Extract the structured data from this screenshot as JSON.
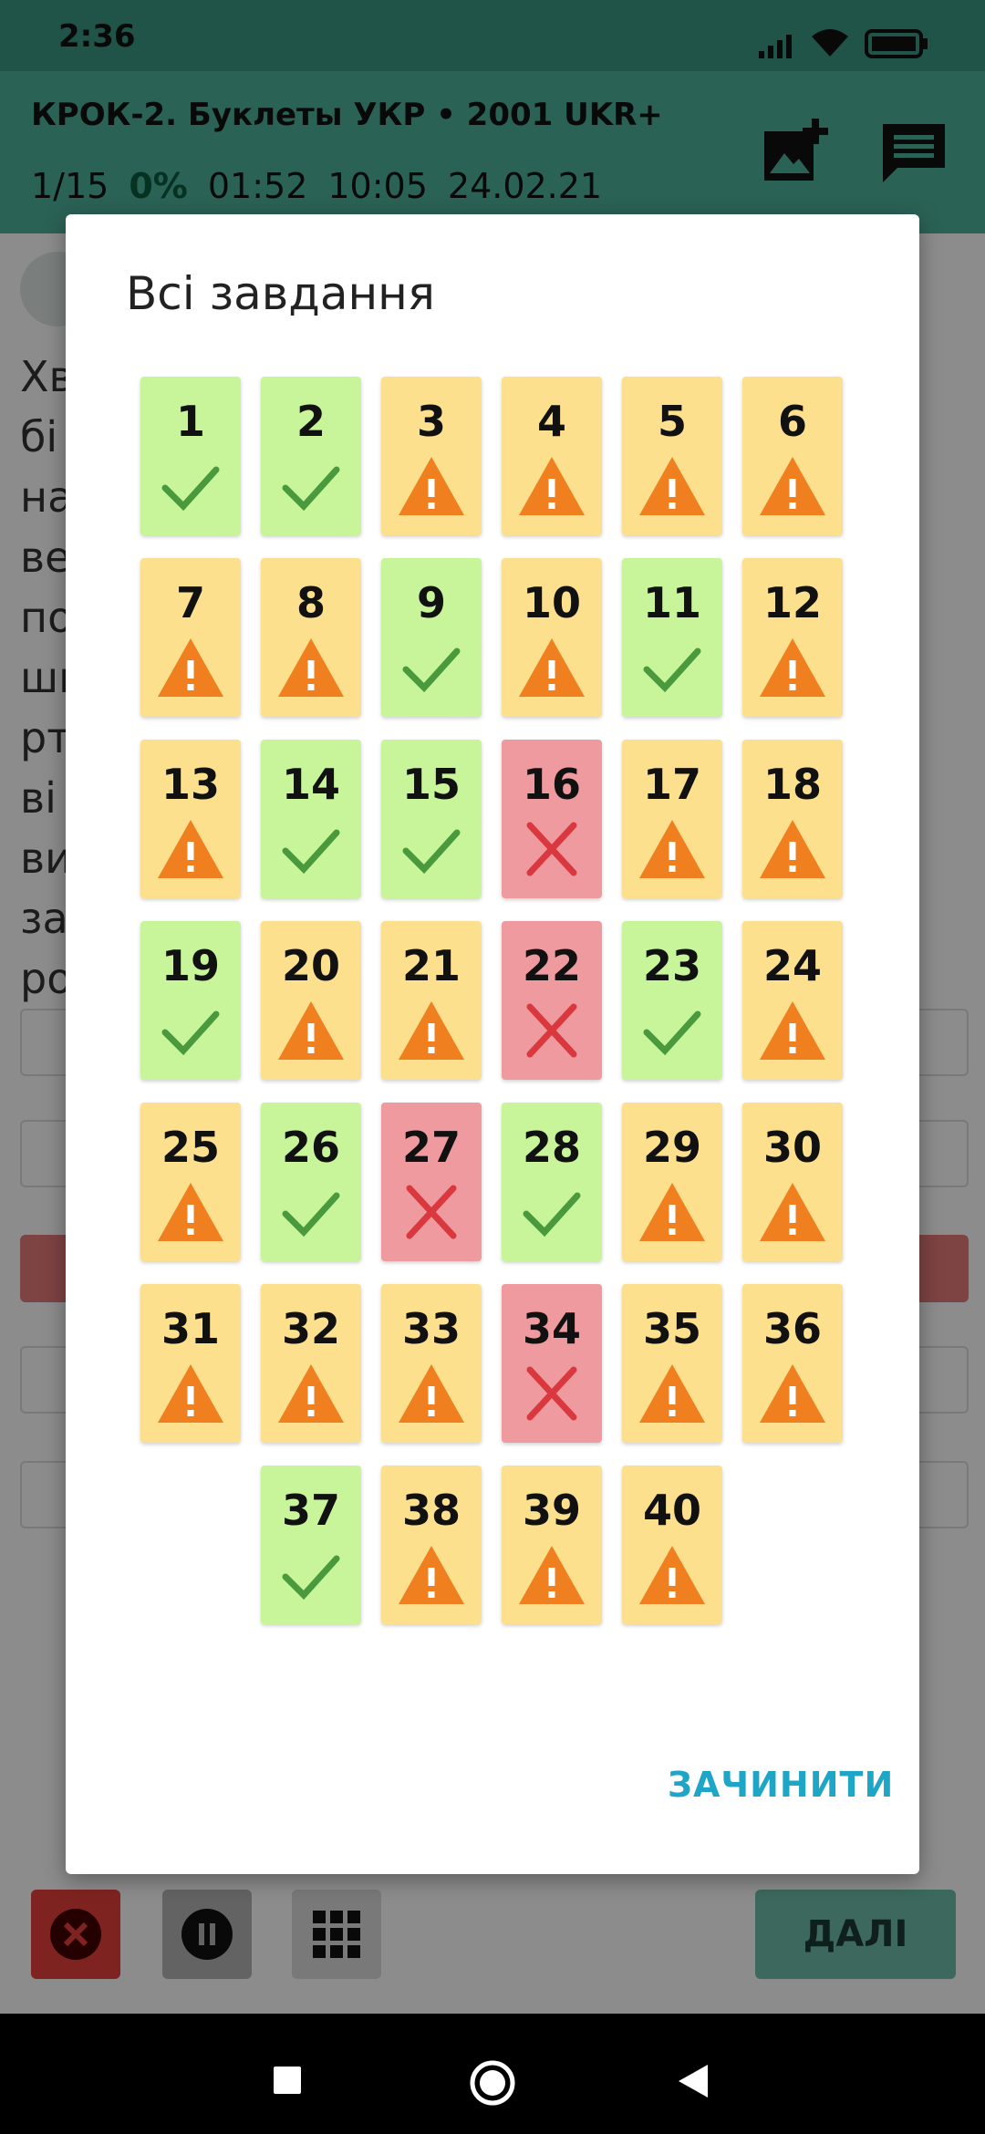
{
  "status_bar": {
    "time": "2:36"
  },
  "app_bar": {
    "title": "КРОК-2. Буклеты УКР • 2001 UKR+",
    "progress": "1/15",
    "percent": "0%",
    "elapsed": "01:52",
    "clock": "10:05",
    "date": "24.02.21"
  },
  "background": {
    "next_label": "ДАЛІ"
  },
  "dialog": {
    "title": "Всі завдання",
    "close_label": "ЗАЧИНИТИ",
    "tasks": [
      {
        "number": "1",
        "status": "correct"
      },
      {
        "number": "2",
        "status": "correct"
      },
      {
        "number": "3",
        "status": "warning"
      },
      {
        "number": "4",
        "status": "warning"
      },
      {
        "number": "5",
        "status": "warning"
      },
      {
        "number": "6",
        "status": "warning"
      },
      {
        "number": "7",
        "status": "warning"
      },
      {
        "number": "8",
        "status": "warning"
      },
      {
        "number": "9",
        "status": "correct"
      },
      {
        "number": "10",
        "status": "warning"
      },
      {
        "number": "11",
        "status": "correct"
      },
      {
        "number": "12",
        "status": "warning"
      },
      {
        "number": "13",
        "status": "warning"
      },
      {
        "number": "14",
        "status": "correct"
      },
      {
        "number": "15",
        "status": "correct"
      },
      {
        "number": "16",
        "status": "wrong"
      },
      {
        "number": "17",
        "status": "warning"
      },
      {
        "number": "18",
        "status": "warning"
      },
      {
        "number": "19",
        "status": "correct"
      },
      {
        "number": "20",
        "status": "warning"
      },
      {
        "number": "21",
        "status": "warning"
      },
      {
        "number": "22",
        "status": "wrong"
      },
      {
        "number": "23",
        "status": "correct"
      },
      {
        "number": "24",
        "status": "warning"
      },
      {
        "number": "25",
        "status": "warning"
      },
      {
        "number": "26",
        "status": "correct"
      },
      {
        "number": "27",
        "status": "wrong"
      },
      {
        "number": "28",
        "status": "correct"
      },
      {
        "number": "29",
        "status": "warning"
      },
      {
        "number": "30",
        "status": "warning"
      },
      {
        "number": "31",
        "status": "warning"
      },
      {
        "number": "32",
        "status": "warning"
      },
      {
        "number": "33",
        "status": "warning"
      },
      {
        "number": "34",
        "status": "wrong"
      },
      {
        "number": "35",
        "status": "warning"
      },
      {
        "number": "36",
        "status": "warning"
      },
      {
        "number": "37",
        "status": "correct"
      },
      {
        "number": "38",
        "status": "warning"
      },
      {
        "number": "39",
        "status": "warning"
      },
      {
        "number": "40",
        "status": "warning"
      }
    ]
  },
  "colors": {
    "correct_bg": "#c8f59a",
    "warning_bg": "#fde08e",
    "wrong_bg": "#ee9a9f",
    "check": "#4a9a3d",
    "warning_icon": "#f07f1f",
    "cross": "#d9383f",
    "close_text": "#1fa5c6"
  }
}
